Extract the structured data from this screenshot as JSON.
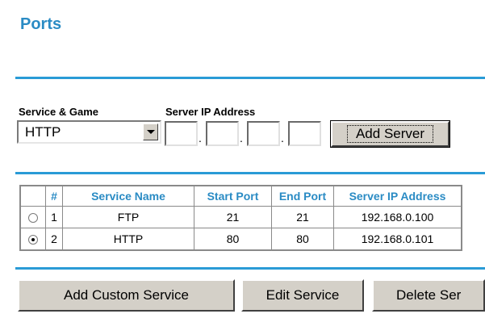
{
  "page": {
    "title": "Ports"
  },
  "form": {
    "service_label": "Service & Game",
    "server_ip_label": "Server IP Address",
    "service_selected": "HTTP",
    "ip_octets": [
      "",
      "",
      "",
      ""
    ],
    "ip_separator": ".",
    "add_server_label": "Add Server"
  },
  "table": {
    "headers": [
      "",
      "#",
      "Service Name",
      "Start Port",
      "End Port",
      "Server IP Address"
    ],
    "rows": [
      {
        "selected": false,
        "num": "1",
        "name": "FTP",
        "start": "21",
        "end": "21",
        "ip": "192.168.0.100"
      },
      {
        "selected": true,
        "num": "2",
        "name": "HTTP",
        "start": "80",
        "end": "80",
        "ip": "192.168.0.101"
      }
    ]
  },
  "actions": {
    "add_custom": "Add Custom Service",
    "edit": "Edit Service",
    "delete": "Delete Ser"
  },
  "colors": {
    "accent": "#2a8bc4",
    "rule": "#2a9bd6",
    "button_face": "#d4d0c8"
  }
}
